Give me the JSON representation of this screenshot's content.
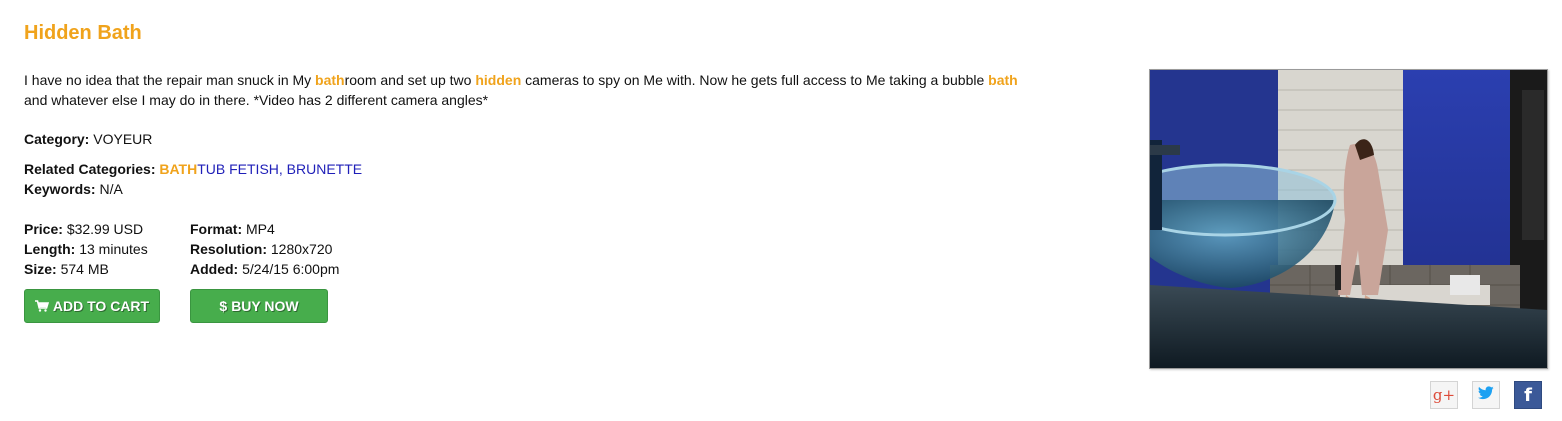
{
  "product": {
    "title": "Hidden Bath",
    "description": {
      "p1": "I have no idea that the repair man snuck in My ",
      "hl1": "bath",
      "p2": "room and set up two ",
      "hl2": "hidden",
      "p3": " cameras to spy on Me with. Now he gets full access to Me taking a bubble ",
      "hl3": "bath",
      "p4": " and whatever else I may do in there. *Video has 2 different camera angles*"
    },
    "category": {
      "label": "Category:",
      "value": "VOYEUR"
    },
    "related": {
      "label": "Related Categories:",
      "highlight": "BATH",
      "rest": "TUB FETISH, BRUNETTE"
    },
    "keywords": {
      "label": "Keywords:",
      "value": "N/A"
    },
    "details_left": [
      {
        "label": "Price:",
        "value": "$32.99 USD"
      },
      {
        "label": "Length:",
        "value": "13 minutes"
      },
      {
        "label": "Size:",
        "value": "574 MB"
      }
    ],
    "details_right": [
      {
        "label": "Format:",
        "value": "MP4"
      },
      {
        "label": "Resolution:",
        "value": "1280x720"
      },
      {
        "label": "Added:",
        "value": "5/24/15 6:00pm"
      }
    ],
    "buttons": {
      "add_to_cart": "ADD TO CART",
      "buy_now_symbol": "$",
      "buy_now": "BUY NOW"
    }
  },
  "share": {
    "google_plus": "g+",
    "twitter": "twitter-icon",
    "facebook": "f"
  },
  "colors": {
    "title": "#f0a31c",
    "link": "#1f1fb8",
    "button": "#47ad4c",
    "facebook": "#3b5998",
    "google": "#dd4b39",
    "twitter": "#1da1f2"
  }
}
